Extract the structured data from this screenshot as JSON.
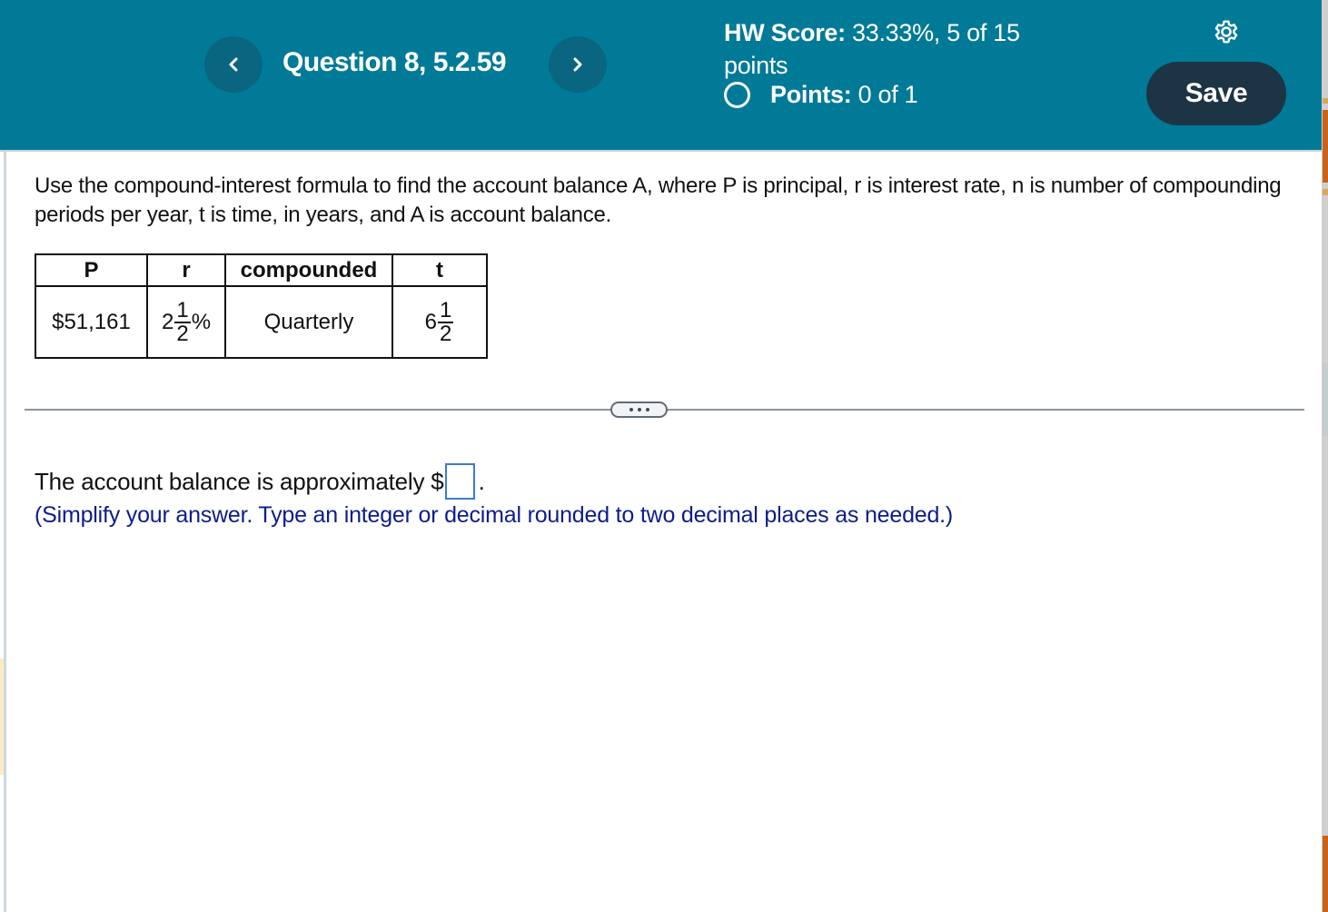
{
  "header": {
    "question_title": "Question 8, 5.2.59",
    "prev_icon": "chevron-left-icon",
    "next_icon": "chevron-right-icon",
    "hw_score_label": "HW Score:",
    "hw_score_value": "33.33%, 5 of 15 points",
    "points_label": "Points:",
    "points_value": "0 of 1",
    "settings_icon": "gear-icon",
    "save_label": "Save"
  },
  "question": {
    "instructions": "Use the compound-interest formula to find the account balance A, where P is principal, r is interest rate, n is number of compounding periods per year, t is time, in years, and A is account balance.",
    "table": {
      "headers": [
        "P",
        "r",
        "compounded",
        "t"
      ],
      "row": {
        "P": "$51,161",
        "r": {
          "whole": "2",
          "numerator": "1",
          "denominator": "2",
          "suffix": "%"
        },
        "compounded": "Quarterly",
        "t": {
          "whole": "6",
          "numerator": "1",
          "denominator": "2"
        }
      }
    },
    "more_button_icon": "ellipsis-icon"
  },
  "answer": {
    "prefix": "The account balance is approximately $",
    "suffix": ".",
    "input_value": "",
    "hint": "(Simplify your answer. Type an integer or decimal rounded to two decimal places as needed.)"
  },
  "colors": {
    "header_bg": "#017a98",
    "nav_button_bg": "#0a6580",
    "save_button_bg": "#1d3444",
    "hint_text": "#0d1d8a",
    "input_border": "#3d7bd4"
  }
}
